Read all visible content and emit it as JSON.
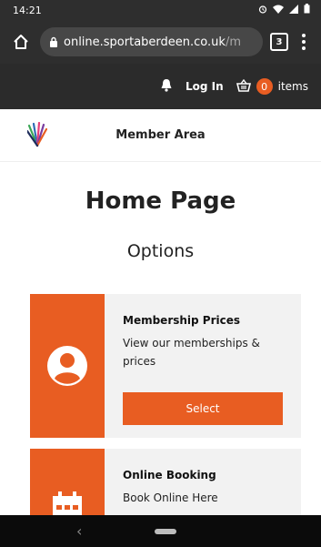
{
  "status_bar": {
    "time": "14:21",
    "icons": [
      "alarm-icon",
      "wifi-icon",
      "signal-icon",
      "battery-icon"
    ]
  },
  "browser": {
    "url_host": "online.sportaberdeen.co.uk",
    "url_path": "/m",
    "tab_count": "3"
  },
  "site_topbar": {
    "login_label": "Log In",
    "cart_count": "0",
    "items_label": "items"
  },
  "header": {
    "title": "Member Area"
  },
  "page": {
    "title": "Home Page",
    "options_title": "Options"
  },
  "cards": [
    {
      "title": "Membership Prices",
      "description": "View our memberships & prices",
      "button_label": "Select",
      "icon": "user-icon"
    },
    {
      "title": "Online Booking",
      "description": "Book Online Here",
      "icon": "calendar-icon"
    }
  ],
  "colors": {
    "accent": "#e85d22",
    "dark_bar": "#2b2b2b",
    "card_bg": "#f2f2f2"
  },
  "nav": {
    "back_glyph": "‹"
  }
}
